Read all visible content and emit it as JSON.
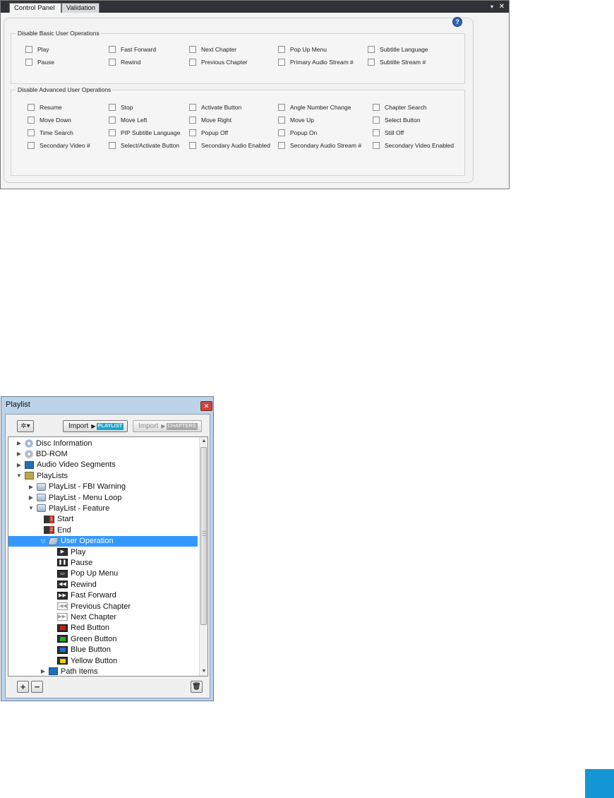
{
  "control_panel": {
    "tabs": [
      {
        "label": "Control Panel"
      },
      {
        "label": "Validation"
      }
    ],
    "pin_glyph": "▾",
    "close_glyph": "✕",
    "help_glyph": "?",
    "basic_group": {
      "title": "Disable Basic User Operations",
      "items": [
        "Play",
        "Fast Forward",
        "Next Chapter",
        "Pop Up Menu",
        "Subtitle Language",
        "Pause",
        "Rewind",
        "Previous Chapter",
        "Primary Audio Stream #",
        "Subtitle Stream #"
      ]
    },
    "advanced_group": {
      "title": "Disable Advanced User Operations",
      "items": [
        "Resume",
        "Stop",
        "Activate Button",
        "Angle Number Change",
        "Chapter Search",
        "Move Down",
        "Move Left",
        "Move Right",
        "Move Up",
        "Select Button",
        "Time Search",
        "PIP Subtitle Language",
        "Popup Off",
        "Popup On",
        "Still Off",
        "Secondary Video #",
        "Select/Activate Button",
        "Secondary Audio Enabled",
        "Secondary Audio Stream #",
        "Secondary Video Enabled"
      ]
    }
  },
  "playlist": {
    "title": "Playlist",
    "close_glyph": "✕",
    "gear_glyph": "✲▾",
    "import_playlist": {
      "label": "Import",
      "tag": "PLAYLIST"
    },
    "import_chapters": {
      "label": "Import",
      "tag": "CHAPTERS"
    },
    "tree": [
      {
        "label": "Disc Information",
        "level": 0,
        "twisty": "▶",
        "icon": "disc-info-icon"
      },
      {
        "label": "BD-ROM",
        "level": 0,
        "twisty": "▶",
        "icon": "disc-icon"
      },
      {
        "label": "Audio Video Segments",
        "level": 0,
        "twisty": "▶",
        "icon": "folder-blue-icon"
      },
      {
        "label": "PlayLists",
        "level": 0,
        "twisty": "▼",
        "icon": "folder-yellow-icon"
      },
      {
        "label": "PlayList - FBI Warning",
        "level": 1,
        "twisty": "▶",
        "icon": "playlist-icon"
      },
      {
        "label": "PlayList - Menu Loop",
        "level": 1,
        "twisty": "▶",
        "icon": "playlist-icon"
      },
      {
        "label": "PlayList - Feature",
        "level": 1,
        "twisty": "▼",
        "icon": "playlist-icon"
      },
      {
        "label": "Start",
        "level": 2,
        "twisty": "",
        "icon": "start-mark-icon",
        "badge": "1"
      },
      {
        "label": "End",
        "level": 2,
        "twisty": "",
        "icon": "end-mark-icon",
        "badge": "2"
      },
      {
        "label": "User Operation",
        "level": 2,
        "twisty": "▽",
        "icon": "user-operation-icon",
        "selected": true
      },
      {
        "label": "Play",
        "level": 3,
        "twisty": "",
        "icon": "play-icon",
        "glyph": "▶"
      },
      {
        "label": "Pause",
        "level": 3,
        "twisty": "",
        "icon": "pause-icon",
        "glyph": "❚❚"
      },
      {
        "label": "Pop Up Menu",
        "level": 3,
        "twisty": "",
        "icon": "popup-menu-icon",
        "glyph": "▭"
      },
      {
        "label": "Rewind",
        "level": 3,
        "twisty": "",
        "icon": "rewind-icon",
        "glyph": "◀◀"
      },
      {
        "label": "Fast Forward",
        "level": 3,
        "twisty": "",
        "icon": "fast-forward-icon",
        "glyph": "▶▶"
      },
      {
        "label": "Previous Chapter",
        "level": 3,
        "twisty": "",
        "icon": "previous-chapter-icon",
        "glyph": "|◀◀",
        "disabled": true
      },
      {
        "label": "Next Chapter",
        "level": 3,
        "twisty": "",
        "icon": "next-chapter-icon",
        "glyph": "▶▶|",
        "disabled": true
      },
      {
        "label": "Red Button",
        "level": 3,
        "twisty": "",
        "icon": "red-button-icon",
        "color": "#d01818"
      },
      {
        "label": "Green Button",
        "level": 3,
        "twisty": "",
        "icon": "green-button-icon",
        "color": "#22b022"
      },
      {
        "label": "Blue Button",
        "level": 3,
        "twisty": "",
        "icon": "blue-button-icon",
        "color": "#1e6fd6"
      },
      {
        "label": "Yellow Button",
        "level": 3,
        "twisty": "",
        "icon": "yellow-button-icon",
        "color": "#f0d000"
      },
      {
        "label": "Path Items",
        "level": 2,
        "twisty": "▶",
        "icon": "folder-blue-icon"
      }
    ],
    "scroll_up_glyph": "▲",
    "scroll_down_glyph": "▼",
    "add_glyph": "+",
    "remove_glyph": "−",
    "trash_glyph": "🗑"
  },
  "colors": {
    "selection": "#3399ff",
    "corner_square": "#1596d4"
  }
}
